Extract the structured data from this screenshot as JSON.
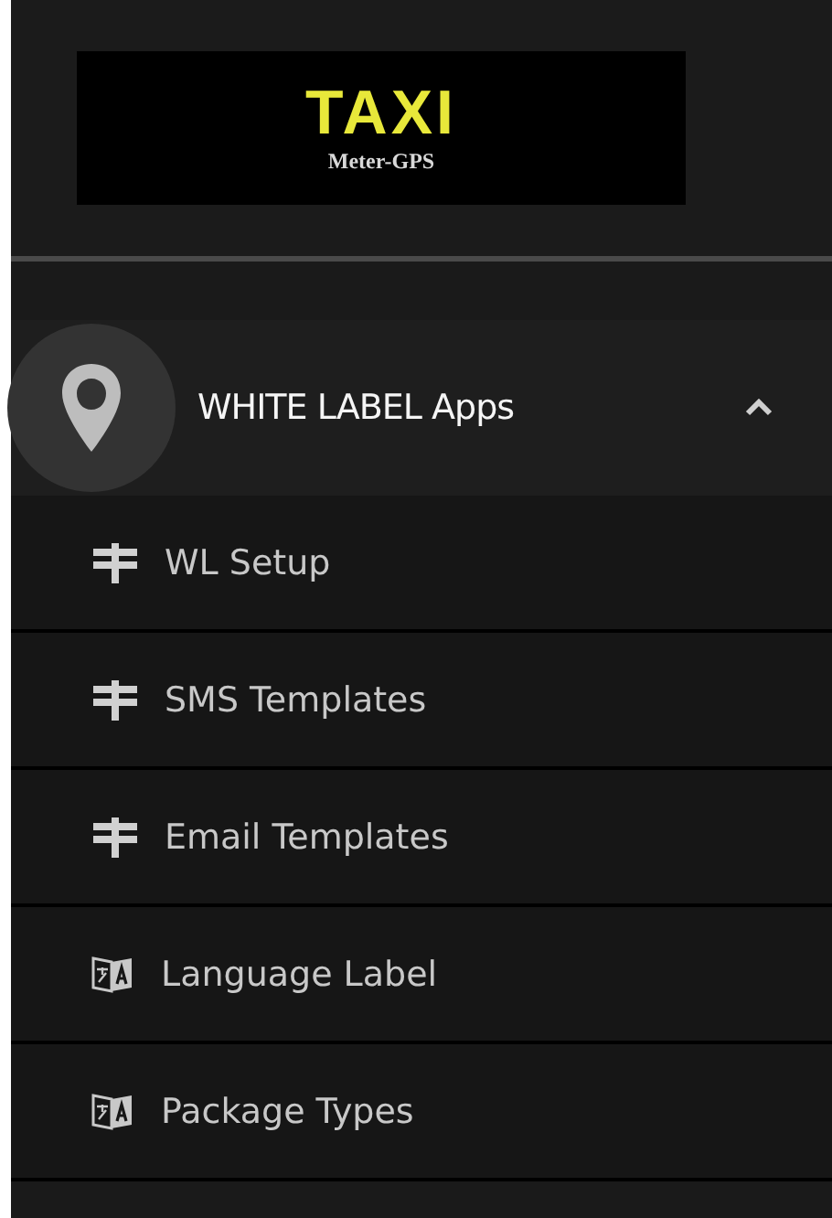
{
  "logo": {
    "title": "TAXI",
    "subtitle": "Meter-GPS"
  },
  "menu_group": {
    "label": "WHITE LABEL Apps",
    "expanded": true,
    "items": [
      {
        "label": "WL Setup",
        "kind": "signpost"
      },
      {
        "label": "SMS Templates",
        "kind": "signpost"
      },
      {
        "label": "Email Templates",
        "kind": "signpost"
      },
      {
        "label": "Language Label",
        "kind": "translate"
      },
      {
        "label": "Package Types",
        "kind": "translate"
      }
    ]
  }
}
